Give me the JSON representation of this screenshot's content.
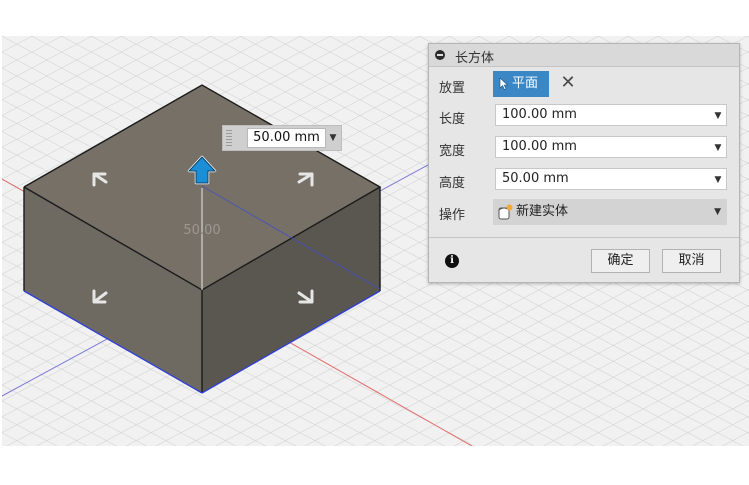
{
  "canvas": {
    "dimension_label": "50.00",
    "dimension_input": {
      "value": "50.00 mm"
    }
  },
  "dialog": {
    "title": "长方体",
    "rows": {
      "placement": {
        "label": "放置",
        "select_label": "平面"
      },
      "length": {
        "label": "长度",
        "value": "100.00 mm"
      },
      "width": {
        "label": "宽度",
        "value": "100.00 mm"
      },
      "height": {
        "label": "高度",
        "value": "50.00 mm"
      },
      "operation": {
        "label": "操作",
        "value": "新建实体"
      }
    },
    "ok_label": "确定",
    "cancel_label": "取消"
  },
  "icons": {
    "collapse": "collapse-icon",
    "cursor": "select-cursor-icon",
    "clear": "close-icon",
    "body": "new-body-icon",
    "info": "info-icon",
    "dropdown": "chevron-down-icon"
  },
  "colors": {
    "accent": "#3b87c6",
    "box_face_top": "#767066",
    "box_face_left": "#6e6a62",
    "box_face_right": "#5a5650",
    "manipulator_arrow": "#1a8fd6"
  }
}
